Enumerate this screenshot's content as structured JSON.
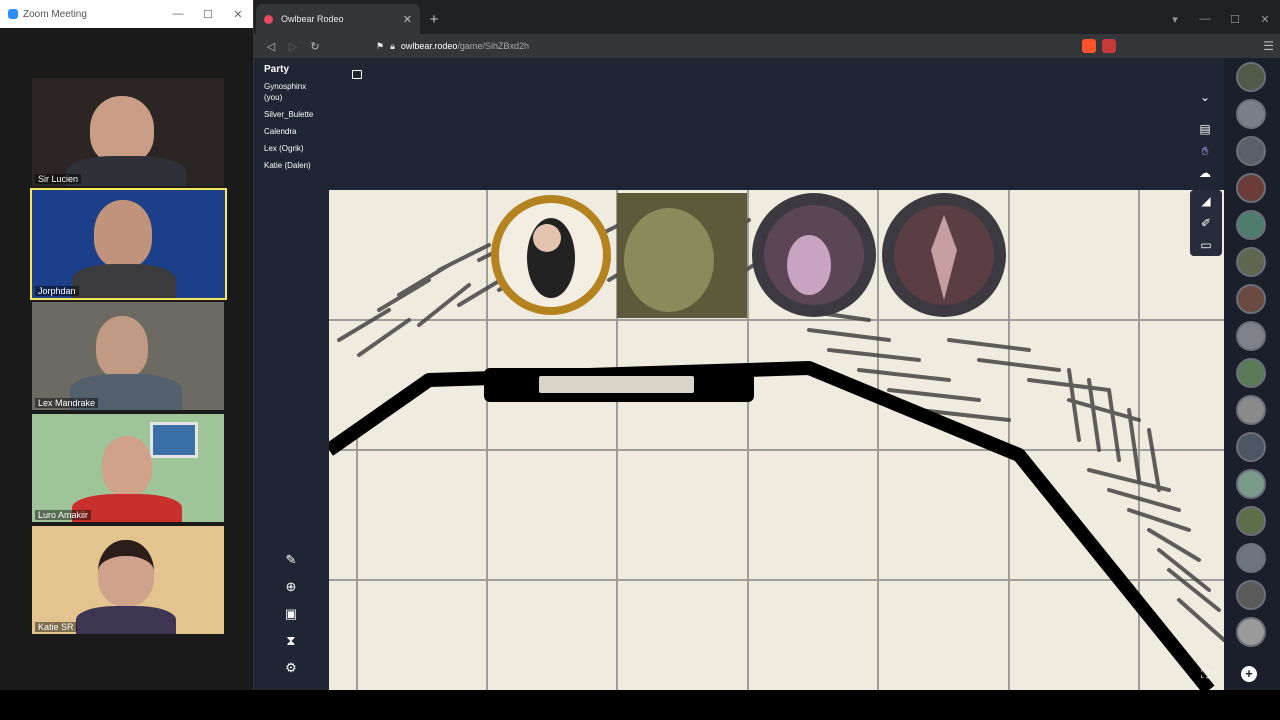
{
  "zoom": {
    "title": "Zoom Meeting",
    "participants": [
      {
        "name": "Sir Lucien"
      },
      {
        "name": "Jorphdan"
      },
      {
        "name": "Lex Mandrake"
      },
      {
        "name": "Luro Amakiir"
      },
      {
        "name": "Katie SR"
      }
    ]
  },
  "browser": {
    "tab_title": "Owlbear Rodeo",
    "url_host": "owlbear.rodeo",
    "url_path": "/game/SihZBxd2h"
  },
  "party": {
    "title": "Party",
    "members": [
      "Gynosphinx (you)",
      "Silver_Bulette",
      "Calendra",
      "Lex (Ogrik)",
      "Katie (Dalen)"
    ]
  },
  "icons": {
    "left_tools": [
      "pencil-icon",
      "add-person-icon",
      "radio-icon",
      "timer-icon",
      "gear-icon"
    ],
    "right_tools": [
      "chevron-down-icon",
      "image-icon",
      "hand-icon",
      "fog-icon",
      "brush-icon"
    ],
    "draw_tools": [
      "ruler-icon",
      "pen-icon",
      "note-icon"
    ]
  },
  "colors": {
    "app_bg": "#1f2532",
    "accent": "#b59bff",
    "map_paper": "#f0ebdf"
  }
}
